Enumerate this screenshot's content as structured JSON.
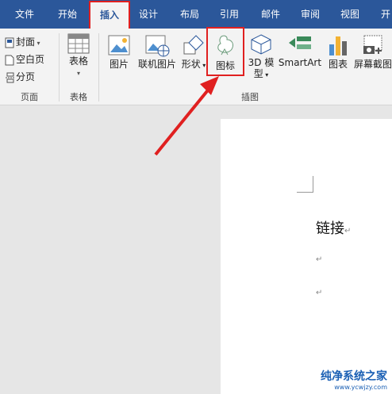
{
  "menu": {
    "tabs": [
      "文件",
      "开始",
      "插入",
      "设计",
      "布局",
      "引用",
      "邮件",
      "审阅",
      "视图",
      "开"
    ],
    "active_index": 2
  },
  "ribbon": {
    "pages_group": {
      "cover": "封面",
      "blank_page": "空白页",
      "page_break": "分页",
      "label": "页面"
    },
    "table_group": {
      "table": "表格",
      "label": "表格"
    },
    "illustrations": {
      "picture": "图片",
      "online_picture": "联机图片",
      "shapes": "形状",
      "icons": "图标",
      "model_3d_line1": "3D 模",
      "model_3d_line2": "型",
      "smartart": "SmartArt",
      "chart": "图表",
      "screenshot": "屏幕截图",
      "label": "插图"
    }
  },
  "document": {
    "text": "链接"
  },
  "watermark": {
    "title": "纯净系统之家",
    "url": "www.ycwjzy.com"
  },
  "colors": {
    "accent": "#2b579a",
    "highlight": "#e02020"
  }
}
